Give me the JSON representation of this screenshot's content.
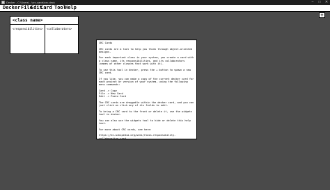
{
  "window": {
    "title": "Decker - C:\\Users\\...\\crc-cards\\crc.deck",
    "controls": [
      "–",
      "□",
      "✕"
    ]
  },
  "menubar": {
    "items": [
      "Decker",
      "File",
      "Edit",
      "Card",
      "Tool",
      "Help"
    ]
  },
  "toolbar": {
    "add_button_label": "+"
  },
  "card": {
    "name": "<class name>",
    "responsibilities": "<responsibilities>",
    "collaborators": "<collaborators>"
  },
  "help": {
    "heading": "CRC Cards",
    "paragraphs": [
      "CRC cards are a tool to help you think through object-oriented designs.",
      "For each important class in your system, you create a card with a class name, its responsibilities, and its collaborators (names of other classes that work with it).",
      "To use this tool in decker, press the + button to spawn a new CRC card.",
      "If you like, you can make a copy of the current decker card for each project or version of your system, using the following menu commands:",
      "Card -> Copy\nFile -> New Card\nEdit -> Paste Card",
      "The CRC cards are draggable within the decker card, and you can just click on click any of its fields to edit.",
      "To bring a CRC card to the front or delete it, use the widgets tool in decker.",
      "You can also use the widgets tool to hide or delete this help text.",
      "For more about CRC cards, see here:",
      "https://en.wikipedia.org/wiki/Class-responsibility-collaboration_card"
    ]
  }
}
